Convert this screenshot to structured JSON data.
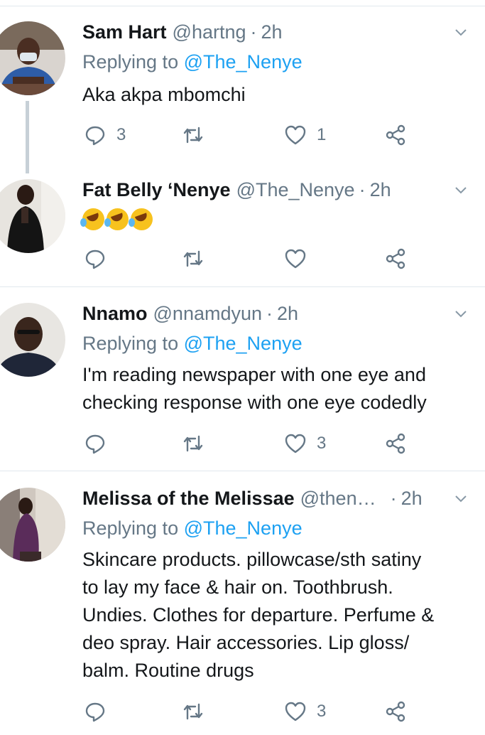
{
  "tweets": [
    {
      "name": "Sam Hart",
      "handle": "@hartng",
      "time": "2h",
      "replying_prefix": "Replying to",
      "replying_to": "@The_Nenye",
      "text": "Aka akpa mbomchi",
      "replies": "3",
      "retweets": "",
      "likes": "1"
    },
    {
      "name": "Fat Belly ‘Nenye",
      "handle": "@The_Nenye",
      "time": "2h",
      "emoji": "rolling-on-floor-laughing x3",
      "replies": "",
      "retweets": "",
      "likes": ""
    },
    {
      "name": "Nnamo",
      "handle": "@nnamdyun",
      "time": "2h",
      "replying_prefix": "Replying to",
      "replying_to": "@The_Nenye",
      "text_lines": [
        "I'm reading newspaper with one eye and",
        "checking response with one eye codedly"
      ],
      "replies": "",
      "retweets": "",
      "likes": "3"
    },
    {
      "name": "Melissa of the Melissae",
      "handle": "@then…",
      "time": "2h",
      "replying_prefix": "Replying to",
      "replying_to": "@The_Nenye",
      "text_lines": [
        "Skincare products. pillowcase/sth satiny",
        "to lay my face & hair on. Toothbrush.",
        "Undies. Clothes for departure. Perfume &",
        "deo spray. Hair accessories. Lip gloss/",
        "balm. Routine drugs"
      ],
      "replies": "",
      "retweets": "",
      "likes": "3"
    }
  ],
  "colors": {
    "accent": "#1da1f2",
    "secondary_text": "#657786",
    "separator": "#e1e8ed",
    "thread_line": "#c7d0d7"
  },
  "icons": [
    "reply-icon",
    "retweet-icon",
    "like-icon",
    "share-icon",
    "chevron-down-icon"
  ]
}
